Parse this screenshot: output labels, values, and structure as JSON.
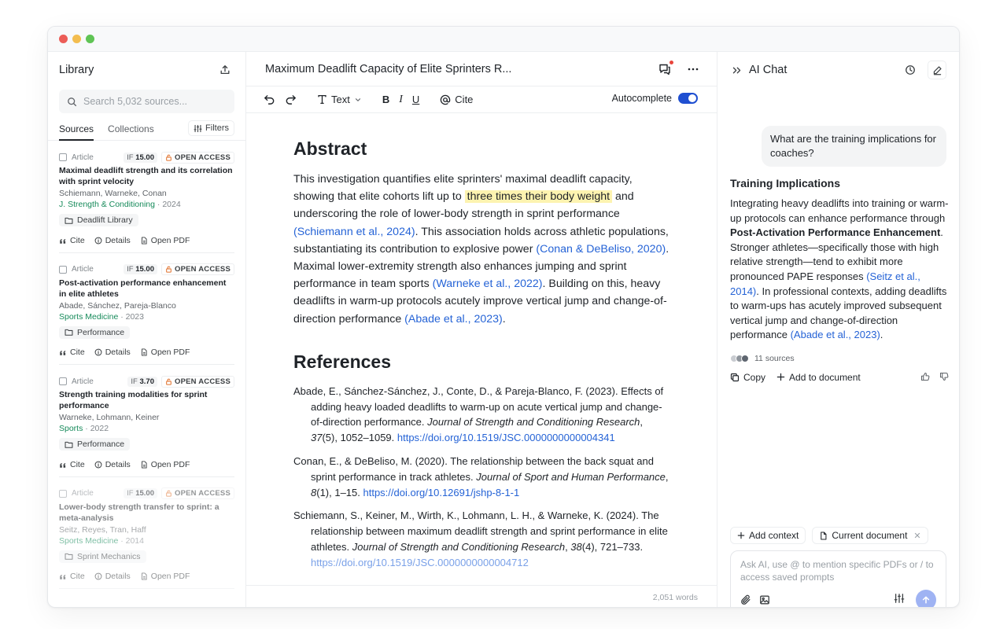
{
  "library": {
    "title": "Library",
    "search_placeholder": "Search 5,032 sources...",
    "tabs": [
      "Sources",
      "Collections"
    ],
    "filters_label": "Filters",
    "items": [
      {
        "type": "Article",
        "if_label": "IF",
        "if_value": "15.00",
        "oa": "OPEN ACCESS",
        "title": "Maximal deadlift strength and its correlation with sprint velocity",
        "authors": "Schiemann, Warneke, Conan",
        "journal": "J. Strength & Conditioning",
        "year": "· 2024",
        "folder": "Deadlift Library",
        "actions": [
          "Cite",
          "Details",
          "Open PDF"
        ]
      },
      {
        "type": "Article",
        "if_label": "IF",
        "if_value": "15.00",
        "oa": "OPEN ACCESS",
        "title": "Post-activation performance enhancement in elite athletes",
        "authors": "Abade, Sánchez, Pareja-Blanco",
        "journal": "Sports Medicine",
        "year": "· 2023",
        "folder": "Performance",
        "actions": [
          "Cite",
          "Details",
          "Open PDF"
        ]
      },
      {
        "type": "Article",
        "if_label": "IF",
        "if_value": "3.70",
        "oa": "OPEN ACCESS",
        "title": "Strength training modalities for sprint performance",
        "authors": "Warneke, Lohmann, Keiner",
        "journal": "Sports",
        "year": "· 2022",
        "folder": "Performance",
        "actions": [
          "Cite",
          "Details",
          "Open PDF"
        ]
      },
      {
        "type": "Article",
        "if_label": "IF",
        "if_value": "15.00",
        "oa": "OPEN ACCESS",
        "title": "Lower-body strength transfer to sprint: a meta-analysis",
        "authors": "Seitz, Reyes, Tran, Haff",
        "journal": "Sports Medicine",
        "year": "· 2014",
        "folder": "Sprint Mechanics",
        "actions": [
          "Cite",
          "Details",
          "Open PDF"
        ]
      }
    ]
  },
  "editor": {
    "doc_title": "Maximum Deadlift Capacity of Elite Sprinters R...",
    "toolbar": {
      "text_style": "Text",
      "bold": "B",
      "italic": "I",
      "underline": "U",
      "cite": "Cite",
      "autocomplete": "Autocomplete"
    },
    "abstract_heading": "Abstract",
    "abstract": [
      {
        "t": "This investigation quantifies elite sprinters' maximal deadlift capacity, showing that elite cohorts lift up to "
      },
      {
        "t": "three times their body weight",
        "k": "hl"
      },
      {
        "t": " and underscoring the role of lower-body strength in sprint performance "
      },
      {
        "t": "(Schiemann et al., 2024)",
        "k": "cite"
      },
      {
        "t": ". This association holds across athletic populations, substantiating its contribution to explosive power "
      },
      {
        "t": "(Conan & DeBeliso, 2020)",
        "k": "cite"
      },
      {
        "t": ". Maximal lower-extremity strength also enhances jumping and sprint performance in team sports "
      },
      {
        "t": "(Warneke et al., 2022)",
        "k": "cite"
      },
      {
        "t": ". Building on this, heavy deadlifts in warm-up protocols acutely improve vertical jump and change-of-direction performance "
      },
      {
        "t": "(Abade et al., 2023)",
        "k": "cite"
      },
      {
        "t": "."
      }
    ],
    "references_heading": "References",
    "references": [
      {
        "pre": "Abade, E., Sánchez-Sánchez, J., Conte, D., & Pareja-Blanco, F. (2023). Effects of adding heavy loaded deadlifts to warm-up on acute vertical jump and change-of-direction performance. ",
        "journal": "Journal of Strength and Conditioning Research",
        "sep": ", ",
        "vol": "37",
        "post": "(5), 1052–1059. ",
        "doi": "https://doi.org/10.1519/JSC.0000000000004341"
      },
      {
        "pre": "Conan, E., & DeBeliso, M. (2020). The relationship between the back squat and sprint performance in track athletes. ",
        "journal": "Journal of Sport and Human Performance",
        "sep": ", ",
        "vol": "8",
        "post": "(1), 1–15. ",
        "doi": "https://doi.org/10.12691/jshp-8-1-1"
      },
      {
        "pre": "Schiemann, S., Keiner, M., Wirth, K., Lohmann, L. H., & Warneke, K. (2024). The relationship between maximum deadlift strength and sprint performance in elite athletes. ",
        "journal": "Journal of Strength and Conditioning Research",
        "sep": ", ",
        "vol": "38",
        "post": "(4), 721–733. ",
        "doi": "https://doi.org/10.1519/JSC.0000000000004712"
      }
    ],
    "word_count": "2,051 words"
  },
  "chat": {
    "title": "AI Chat",
    "user_message": "What are the training implications for coaches?",
    "response_heading": "Training Implications",
    "response": [
      {
        "t": "Integrating heavy deadlifts into training or warm-up protocols can enhance performance through "
      },
      {
        "t": "Post-Activation Performance Enhancement",
        "k": "b"
      },
      {
        "t": ". Stronger athletes—specifically those with high relative strength—tend to exhibit more pronounced PAPE responses "
      },
      {
        "t": "(Seitz et al., 2014)",
        "k": "cite"
      },
      {
        "t": ". In professional contexts, adding deadlifts to warm-ups has acutely improved subsequent vertical jump and change-of-direction performance "
      },
      {
        "t": "(Abade et al., 2023)",
        "k": "cite"
      },
      {
        "t": "."
      }
    ],
    "sources_count": "11 sources",
    "source_dot_colors": [
      "#c9ccd1",
      "#8f959c",
      "#5f6670"
    ],
    "copy_label": "Copy",
    "add_doc_label": "Add to document",
    "add_context_label": "Add context",
    "current_doc_label": "Current document",
    "input_placeholder": "Ask AI, use @ to mention specific PDFs or / to access saved prompts"
  },
  "colors": {
    "accent": "#1f4fd1",
    "cite": "#2563d6",
    "highlight": "#fdf3b0",
    "journal_green": "#168a5a"
  }
}
